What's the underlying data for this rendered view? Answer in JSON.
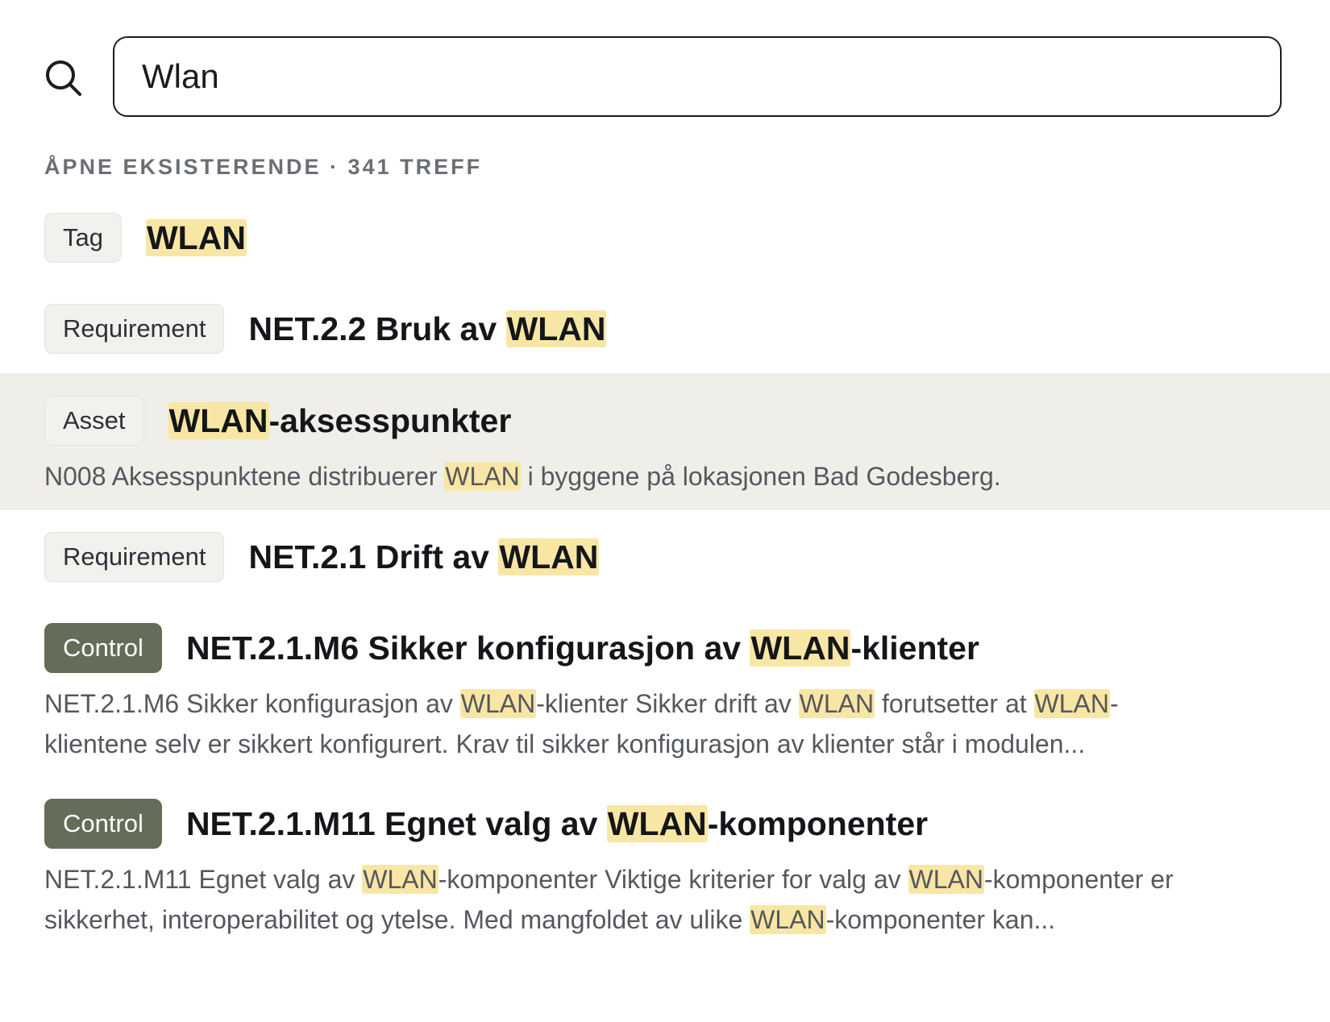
{
  "search": {
    "value": "Wlan",
    "icon": "search-icon"
  },
  "section": {
    "header": "ÅPNE EKSISTERENDE · 341 TREFF"
  },
  "colors": {
    "highlight": "#f8e7a4",
    "control_badge": "#646d58",
    "active_row": "#efeee9"
  },
  "results": [
    {
      "type": "Tag",
      "title": [
        {
          "t": "WLAN",
          "h": true
        }
      ],
      "description": []
    },
    {
      "type": "Requirement",
      "title": [
        {
          "t": "NET.2.2 Bruk av ",
          "h": false
        },
        {
          "t": "WLAN",
          "h": true
        }
      ],
      "description": []
    },
    {
      "type": "Asset",
      "title": [
        {
          "t": "WLAN",
          "h": true
        },
        {
          "t": "-aksesspunkter",
          "h": false
        }
      ],
      "description": [
        {
          "t": "N008 Aksesspunktene distribuerer ",
          "h": false
        },
        {
          "t": "WLAN",
          "h": true
        },
        {
          "t": " i byggene på lokasjonen Bad Godesberg.",
          "h": false
        }
      ],
      "active": true
    },
    {
      "type": "Requirement",
      "title": [
        {
          "t": "NET.2.1 Drift av ",
          "h": false
        },
        {
          "t": "WLAN",
          "h": true
        }
      ],
      "description": []
    },
    {
      "type": "Control",
      "title": [
        {
          "t": "NET.2.1.M6 Sikker konfigurasjon av ",
          "h": false
        },
        {
          "t": "WLAN",
          "h": true
        },
        {
          "t": "-klienter",
          "h": false
        }
      ],
      "description": [
        {
          "t": "NET.2.1.M6 Sikker konfigurasjon av ",
          "h": false
        },
        {
          "t": "WLAN",
          "h": true
        },
        {
          "t": "-klienter Sikker drift av ",
          "h": false
        },
        {
          "t": "WLAN",
          "h": true
        },
        {
          "t": " forutsetter at ",
          "h": false
        },
        {
          "t": "WLAN",
          "h": true
        },
        {
          "t": "-klientene selv er sikkert konfigurert. Krav til sikker konfigurasjon av klienter står i modulen...",
          "h": false
        }
      ]
    },
    {
      "type": "Control",
      "title": [
        {
          "t": "NET.2.1.M11 Egnet valg av ",
          "h": false
        },
        {
          "t": "WLAN",
          "h": true
        },
        {
          "t": "-komponenter",
          "h": false
        }
      ],
      "description": [
        {
          "t": "NET.2.1.M11 Egnet valg av ",
          "h": false
        },
        {
          "t": "WLAN",
          "h": true
        },
        {
          "t": "-komponenter Viktige kriterier for valg av ",
          "h": false
        },
        {
          "t": "WLAN",
          "h": true
        },
        {
          "t": "-komponenter er sikkerhet, interoperabilitet og ytelse. Med mangfoldet av ulike ",
          "h": false
        },
        {
          "t": "WLAN",
          "h": true
        },
        {
          "t": "-komponenter kan...",
          "h": false
        }
      ]
    }
  ]
}
